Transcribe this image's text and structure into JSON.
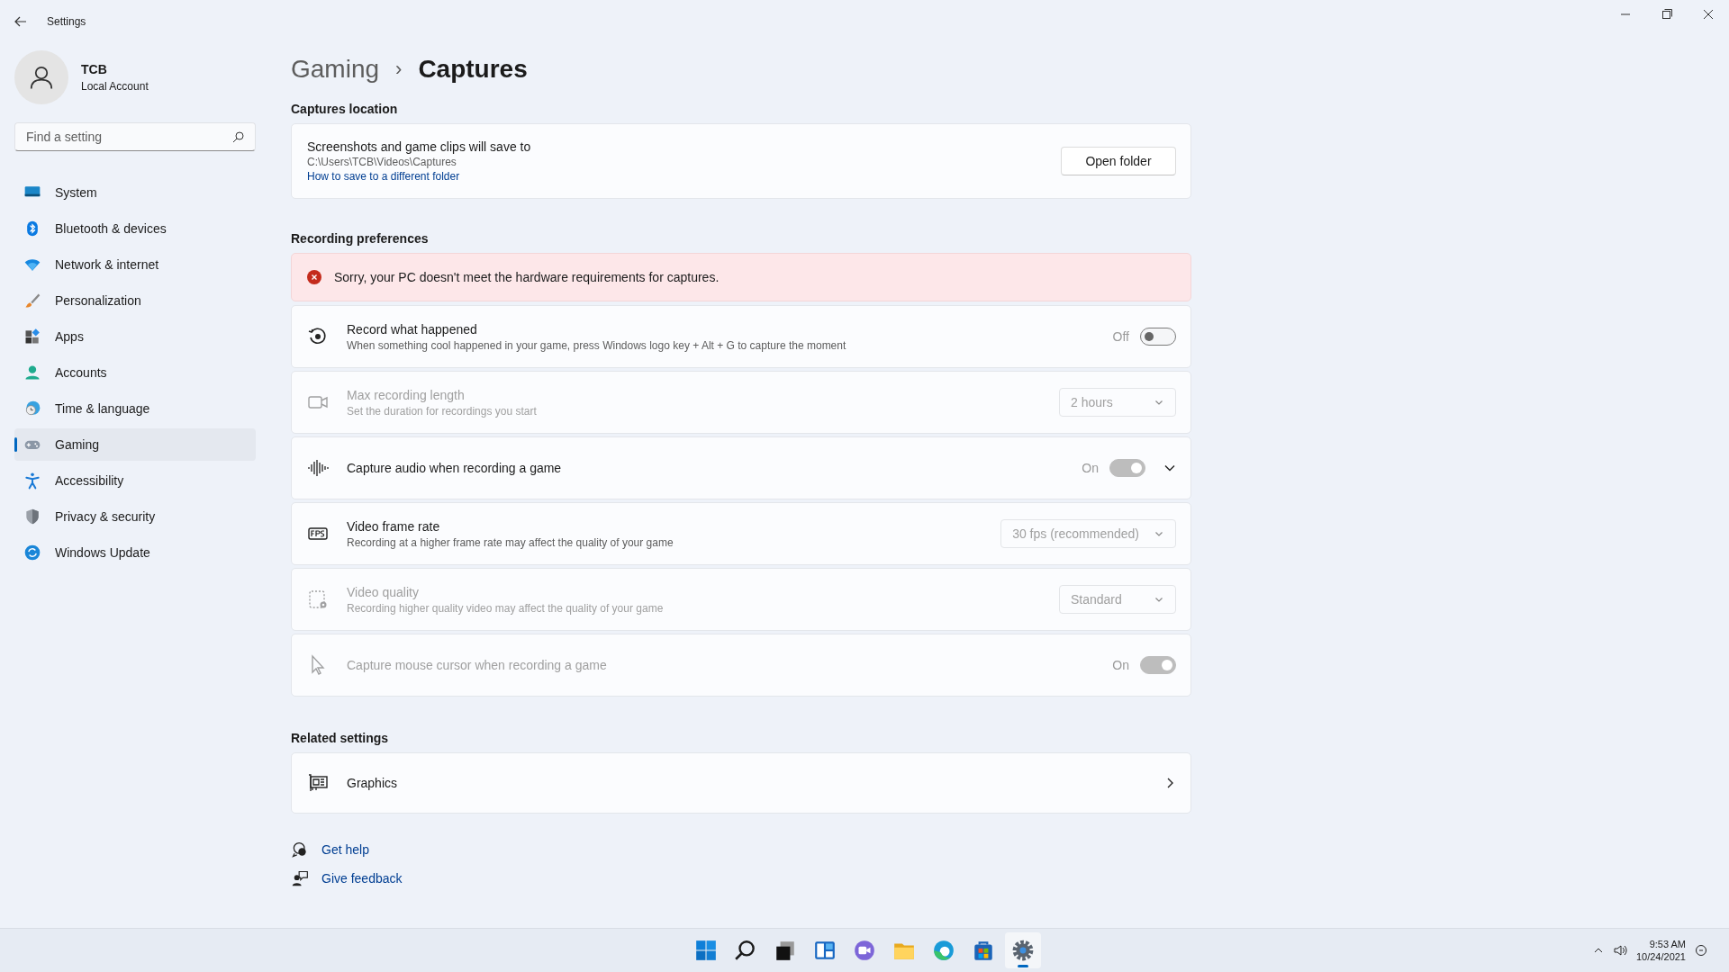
{
  "window": {
    "title": "Settings"
  },
  "profile": {
    "name": "TCB",
    "account": "Local Account"
  },
  "search": {
    "placeholder": "Find a setting"
  },
  "nav": [
    {
      "label": "System",
      "selected": false
    },
    {
      "label": "Bluetooth & devices",
      "selected": false
    },
    {
      "label": "Network & internet",
      "selected": false
    },
    {
      "label": "Personalization",
      "selected": false
    },
    {
      "label": "Apps",
      "selected": false
    },
    {
      "label": "Accounts",
      "selected": false
    },
    {
      "label": "Time & language",
      "selected": false
    },
    {
      "label": "Gaming",
      "selected": true
    },
    {
      "label": "Accessibility",
      "selected": false
    },
    {
      "label": "Privacy & security",
      "selected": false
    },
    {
      "label": "Windows Update",
      "selected": false
    }
  ],
  "breadcrumb": {
    "parent": "Gaming",
    "separator": "›",
    "current": "Captures"
  },
  "captures_location": {
    "heading": "Captures location",
    "title": "Screenshots and game clips will save to",
    "path": "C:\\Users\\TCB\\Videos\\Captures",
    "link": "How to save to a different folder",
    "button": "Open folder"
  },
  "recording_preferences": {
    "heading": "Recording preferences",
    "error": "Sorry, your PC doesn't meet the hardware requirements for captures.",
    "rows": [
      {
        "kind": "toggle",
        "title": "Record what happened",
        "description": "When something cool happened in your game, press Windows logo key + Alt + G to capture the moment",
        "disabled": false,
        "state_label": "Off",
        "on": false,
        "control_disabled": false,
        "expandable": false
      },
      {
        "kind": "dropdown",
        "title": "Max recording length",
        "description": "Set the duration for recordings you start",
        "disabled": true,
        "value": "2 hours",
        "control_disabled": true
      },
      {
        "kind": "toggle",
        "title": "Capture audio when recording a game",
        "disabled": false,
        "state_label": "On",
        "on": true,
        "control_disabled": true,
        "expandable": true
      },
      {
        "kind": "dropdown",
        "title": "Video frame rate",
        "description": "Recording at a higher frame rate may affect the quality of your game",
        "disabled": false,
        "value": "30 fps (recommended)",
        "control_disabled": true
      },
      {
        "kind": "dropdown",
        "title": "Video quality",
        "description": "Recording higher quality video may affect the quality of your game",
        "disabled": true,
        "value": "Standard",
        "control_disabled": true
      },
      {
        "kind": "toggle",
        "title": "Capture mouse cursor when recording a game",
        "disabled": true,
        "state_label": "On",
        "on": true,
        "control_disabled": true,
        "expandable": false
      }
    ]
  },
  "related_settings": {
    "heading": "Related settings",
    "items": [
      {
        "label": "Graphics"
      }
    ]
  },
  "help_links": [
    {
      "label": "Get help"
    },
    {
      "label": "Give feedback"
    }
  ],
  "taskbar": {
    "apps": [
      {
        "selected": false
      },
      {
        "selected": false
      },
      {
        "selected": false
      },
      {
        "selected": false
      },
      {
        "selected": false
      },
      {
        "selected": false
      },
      {
        "selected": false
      },
      {
        "selected": false
      },
      {
        "selected": true
      }
    ],
    "time": "9:53 AM",
    "date": "10/24/2021"
  }
}
